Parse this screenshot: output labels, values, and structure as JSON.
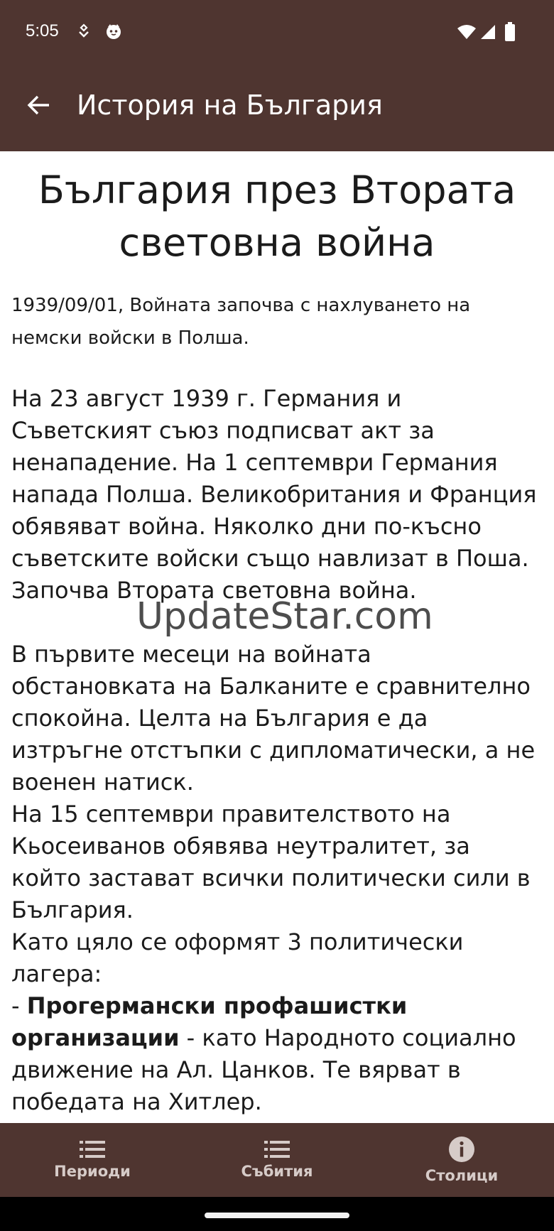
{
  "status_bar": {
    "time": "5:05"
  },
  "app_bar": {
    "title": "История на България"
  },
  "event": {
    "title": "България през Втората световна война",
    "date_line": "1939/09/01, Войната започва с нахлуването на немски войски в Полша.",
    "paragraph_1": "На 23 август 1939 г. Германия и Съветският съюз подписват акт за ненападение. На 1 септември Германия напада Полша. Великобритания и Франция обявяват война. Няколко дни по-късно съветските войски също навлизат в Поша. Започва Втората световна война.",
    "paragraph_2a": "В първите месеци на войната обстановката на Балканите е сравнително спокойна. Целта на България е да изтръгне отстъпки с дипломатически, а не военен натиск.",
    "paragraph_2b": "На 15 септември правителството на Кьосеиванов обявява неутралитет, за който застават всички политически сили в България.",
    "paragraph_2c": "Като цяло се оформят 3 политически лагера:",
    "bullet_prefix": "- ",
    "bullet_1_bold": "Прогермански профашистки организации",
    "bullet_1_rest": " - като Народното социално движение на Ал. Цанков. Те вярват в победата на Хитлер."
  },
  "watermark": {
    "text": "UpdateStar.com"
  },
  "bottom_nav": {
    "items": [
      {
        "label": "Периоди",
        "icon": "list-icon"
      },
      {
        "label": "Събития",
        "icon": "list-icon"
      },
      {
        "label": "Столици",
        "icon": "info-icon"
      }
    ]
  },
  "colors": {
    "primary": "#4f3530",
    "nav_text": "#d6cbc8",
    "text": "#1b1b1b"
  }
}
